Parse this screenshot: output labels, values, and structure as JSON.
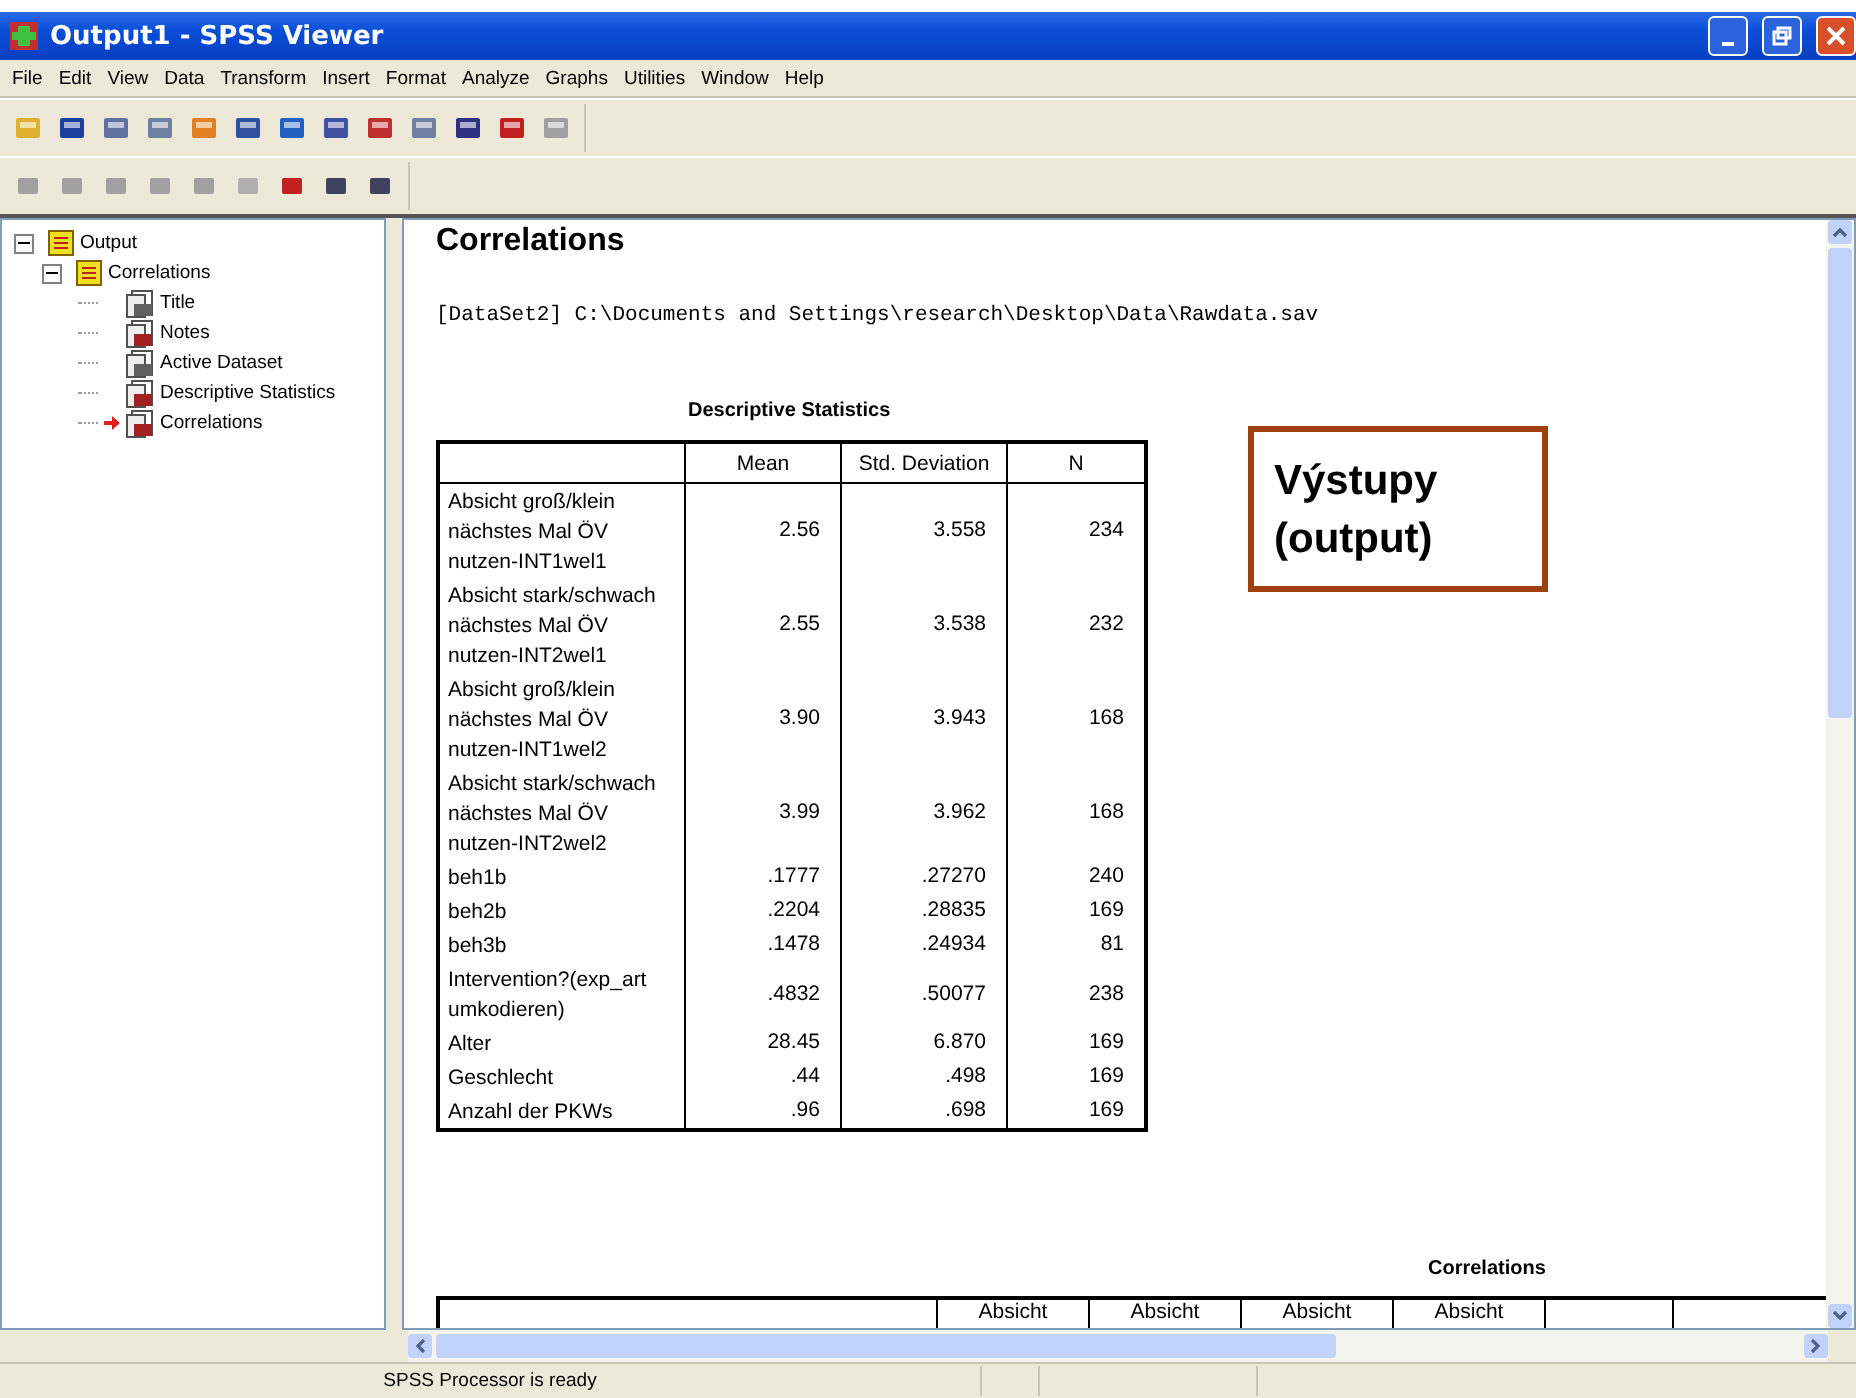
{
  "window": {
    "title": "Output1 - SPSS Viewer"
  },
  "menu": [
    "File",
    "Edit",
    "View",
    "Data",
    "Transform",
    "Insert",
    "Format",
    "Analyze",
    "Graphs",
    "Utilities",
    "Window",
    "Help"
  ],
  "tree": {
    "label": "Output",
    "expanded": true,
    "children": [
      {
        "label": "Correlations",
        "expanded": true,
        "children": [
          {
            "label": "Title",
            "kind": "title",
            "current": false
          },
          {
            "label": "Notes",
            "kind": "notes",
            "current": false
          },
          {
            "label": "Active Dataset",
            "kind": "dataset",
            "current": false
          },
          {
            "label": "Descriptive Statistics",
            "kind": "table",
            "current": false
          },
          {
            "label": "Correlations",
            "kind": "table",
            "current": true
          }
        ]
      }
    ]
  },
  "output": {
    "heading": "Correlations",
    "dataset": "[DataSet2] C:\\Documents and Settings\\research\\Desktop\\Data\\Rawdata.sav",
    "descriptive": {
      "title": "Descriptive Statistics",
      "columns": [
        "Mean",
        "Std. Deviation",
        "N"
      ],
      "rows": [
        {
          "label": "Absicht groß/klein nächstes Mal ÖV nutzen-INT1wel1",
          "values": [
            "2.56",
            "3.558",
            "234"
          ]
        },
        {
          "label": "Absicht stark/schwach nächstes Mal ÖV nutzen-INT2wel1",
          "values": [
            "2.55",
            "3.538",
            "232"
          ]
        },
        {
          "label": "Absicht groß/klein nächstes Mal ÖV nutzen-INT1wel2",
          "values": [
            "3.90",
            "3.943",
            "168"
          ]
        },
        {
          "label": "Absicht stark/schwach nächstes Mal ÖV nutzen-INT2wel2",
          "values": [
            "3.99",
            "3.962",
            "168"
          ]
        },
        {
          "label": "beh1b",
          "values": [
            ".1777",
            ".27270",
            "240"
          ]
        },
        {
          "label": "beh2b",
          "values": [
            ".2204",
            ".28835",
            "169"
          ]
        },
        {
          "label": "beh3b",
          "values": [
            ".1478",
            ".24934",
            "81"
          ]
        },
        {
          "label": "Intervention?(exp_art umkodieren)",
          "values": [
            ".4832",
            ".50077",
            "238"
          ]
        },
        {
          "label": "Alter",
          "values": [
            "28.45",
            "6.870",
            "169"
          ]
        },
        {
          "label": "Geschlecht",
          "values": [
            ".44",
            ".498",
            "169"
          ]
        },
        {
          "label": "Anzahl der PKWs",
          "values": [
            ".96",
            ".698",
            "169"
          ]
        }
      ]
    },
    "callout": [
      "Výstupy",
      "(output)"
    ],
    "correlations": {
      "title": "Correlations",
      "columns": [
        "Absicht",
        "Absicht",
        "Absicht",
        "Absicht"
      ]
    }
  },
  "status_bar": "SPSS Processor is ready"
}
